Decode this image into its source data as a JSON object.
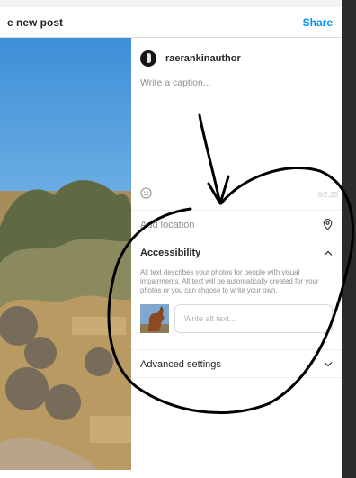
{
  "header": {
    "title": "e new post",
    "share_label": "Share"
  },
  "user": {
    "username": "raerankinauthor"
  },
  "caption": {
    "placeholder": "Write a caption..."
  },
  "caption_counter": "0/2,20",
  "location": {
    "label": "Add location",
    "icon": "location-pin-icon"
  },
  "accessibility": {
    "title": "Accessibility",
    "description": "Alt text describes your photos for people with visual impairments. Alt text will be automatically created for your photos or you can choose to write your own.",
    "alt_placeholder": "Write alt text...",
    "icon": "chevron-up-icon"
  },
  "advanced": {
    "title": "Advanced settings",
    "icon": "chevron-down-icon"
  },
  "colors": {
    "accent": "#0095f6",
    "text": "#262626",
    "muted": "#8e8e8e",
    "divider": "#efefef",
    "annotation": "#000000"
  }
}
